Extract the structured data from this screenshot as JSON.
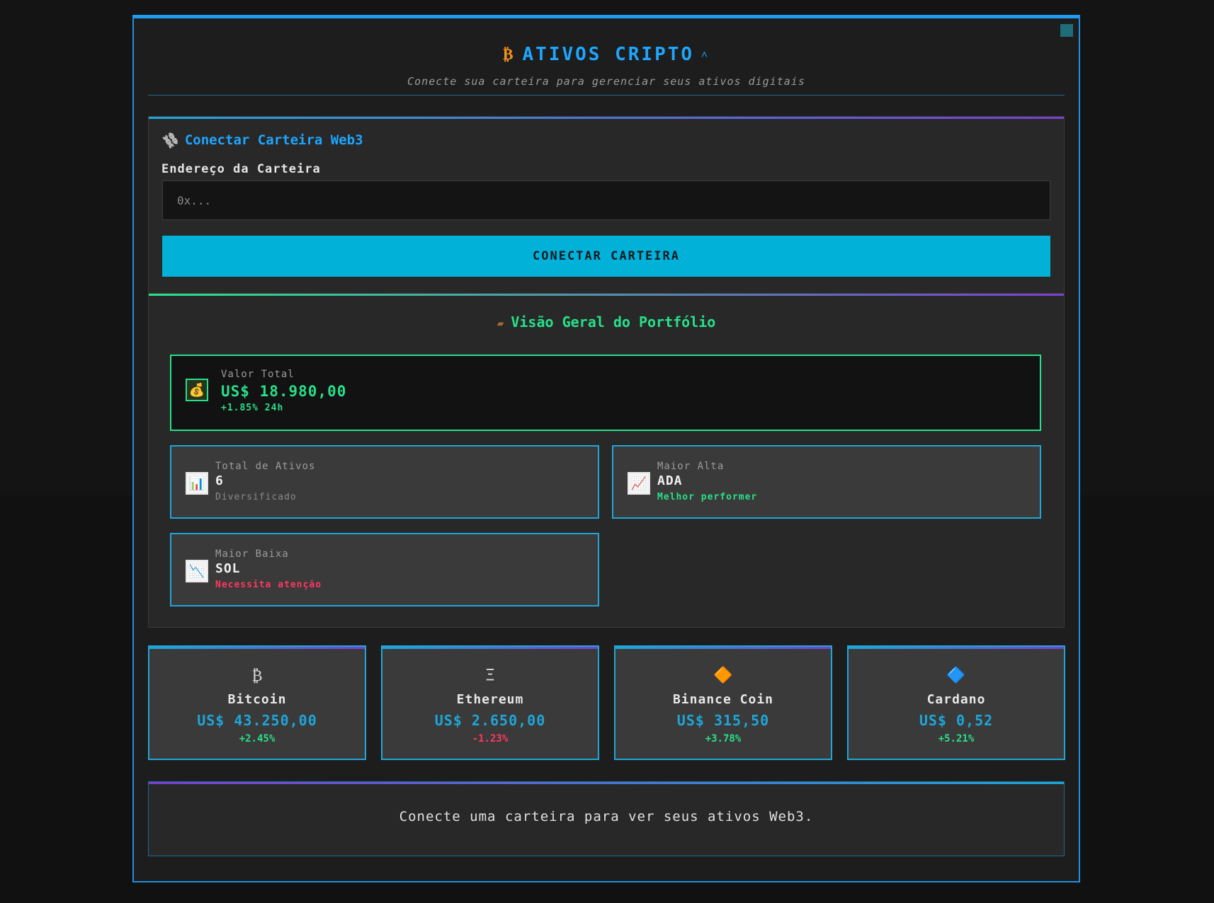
{
  "header": {
    "title": "ATIVOS CRIPTO",
    "title_icon": "₿",
    "caret": "˄",
    "subtitle": "Conecte sua carteira para gerenciar seus ativos digitais"
  },
  "connect": {
    "title": "Conectar Carteira Web3",
    "title_icon": "🔗",
    "address_label": "Endereço da Carteira",
    "address_placeholder": "0x...",
    "address_value": "",
    "button_label": "CONECTAR CARTEIRA"
  },
  "portfolio": {
    "title": "Visão Geral do Portfólio",
    "title_icon": "💼",
    "total": {
      "icon": "💰",
      "label": "Valor Total",
      "value": "US$ 18.980,00",
      "sub": "+1.85% 24h"
    },
    "assets": {
      "icon": "📊",
      "label": "Total de Ativos",
      "value": "6",
      "sub": "Diversificado"
    },
    "top_gain": {
      "icon": "📈",
      "label": "Maior Alta",
      "value": "ADA",
      "sub": "Melhor performer"
    },
    "top_loss": {
      "icon": "📉",
      "label": "Maior Baixa",
      "value": "SOL",
      "sub": "Necessita atenção"
    }
  },
  "coins": [
    {
      "icon": "₿",
      "name": "Bitcoin",
      "price": "US$ 43.250,00",
      "change": "+2.45%"
    },
    {
      "icon": "Ξ",
      "name": "Ethereum",
      "price": "US$ 2.650,00",
      "change": "-1.23%"
    },
    {
      "icon": "🔶",
      "name": "Binance Coin",
      "price": "US$ 315,50",
      "change": "+3.78%"
    },
    {
      "icon": "🔷",
      "name": "Cardano",
      "price": "US$ 0,52",
      "change": "+5.21%"
    }
  ],
  "empty_state": {
    "message": "Conecte uma carteira para ver seus ativos Web3."
  },
  "colors": {
    "accent": "#1ea6ff",
    "button": "#02b1d8",
    "positive": "#27e08a",
    "negative": "#ff3860",
    "bitcoin": "#f7931a"
  }
}
